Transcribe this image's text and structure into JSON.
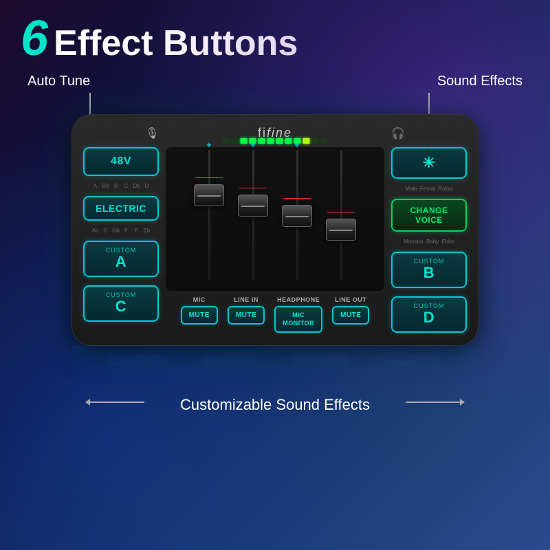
{
  "header": {
    "number": "6",
    "text": "Effect Buttons"
  },
  "annotations": {
    "auto_tune": "Auto Tune",
    "sound_effects": "Sound Effects",
    "customizable": "Customizable Sound Effects"
  },
  "device": {
    "brand": "fifine",
    "left_panel": {
      "btn_48v": "48V",
      "btn_electric": "ELECTRIC",
      "btn_custom_a_label": "CUSTOM",
      "btn_custom_a_letter": "A",
      "btn_custom_c_label": "CUSTOM",
      "btn_custom_c_letter": "C",
      "note_labels_top": [
        "A",
        "Bb",
        "B",
        "C",
        "Db",
        "D"
      ],
      "note_labels_bottom": [
        "Ab",
        "G",
        "Gb",
        "F",
        "E",
        "Eb"
      ]
    },
    "right_panel": {
      "btn_sun": "☀",
      "btn_change_voice": "CHANGE\nVOICE",
      "btn_custom_b_label": "CUSTOM",
      "btn_custom_b_letter": "B",
      "btn_custom_d_label": "CUSTOM",
      "btn_custom_d_letter": "D",
      "voice_labels_top": [
        "Male",
        "Femal",
        "Robot"
      ],
      "voice_labels_bottom": [
        "Monster",
        "Baby",
        "Elder"
      ]
    },
    "channels": [
      {
        "label": "MIC",
        "plus": "+"
      },
      {
        "label": "LINE IN",
        "plus": "+"
      },
      {
        "label": "HEADPHONE",
        "plus": "+"
      },
      {
        "label": "LINE OUT"
      }
    ],
    "mute_buttons": [
      {
        "channel": "MIC",
        "label": "MUTE"
      },
      {
        "channel": "LINE IN",
        "label": "MUTE"
      },
      {
        "channel": "HEADPHONE",
        "label": "MIC\nMONITOR"
      },
      {
        "channel": "LINE OUT",
        "label": "MUTE"
      }
    ]
  }
}
